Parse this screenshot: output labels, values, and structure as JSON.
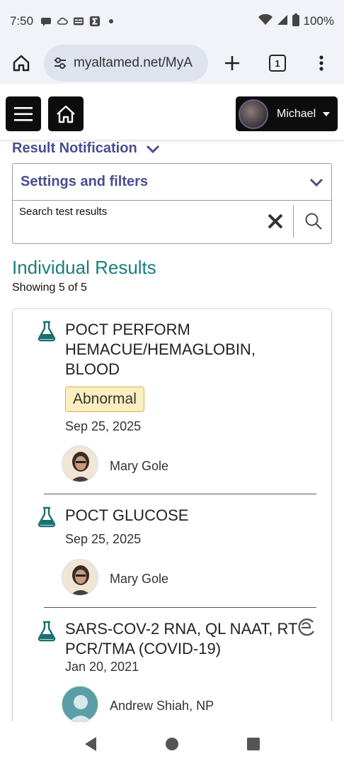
{
  "status_bar": {
    "time": "7:50",
    "battery": "100%",
    "icons": [
      "chat-icon",
      "cloud-icon",
      "news-icon",
      "sigma-app-icon",
      "dot-icon"
    ]
  },
  "browser": {
    "url": "myaltamed.net/MyA",
    "tab_count": "1"
  },
  "header": {
    "user_name": "Michael"
  },
  "result_notification": {
    "label": "Result Notification"
  },
  "settings": {
    "title": "Settings and filters",
    "search_label": "Search test results"
  },
  "results": {
    "title": "Individual Results",
    "showing": "Showing 5 of 5",
    "items": [
      {
        "name": "POCT PERFORM HEMACUE/HEMAGLOBIN, BLOOD",
        "flag": "Abnormal",
        "date": "Sep 25, 2025",
        "provider": "Mary Gole"
      },
      {
        "name": "POCT GLUCOSE",
        "date": "Sep 25, 2025",
        "provider": "Mary Gole"
      },
      {
        "name": "SARS-COV-2 RNA, QL NAAT, RT PCR/TMA (COVID-19)",
        "date": "Jan 20, 2021",
        "provider": "Andrew Shiah, NP"
      }
    ]
  },
  "colors": {
    "accent_purple": "#4b4c8f",
    "accent_teal": "#1b7d7d",
    "abnormal_bg": "#fcefbf"
  }
}
